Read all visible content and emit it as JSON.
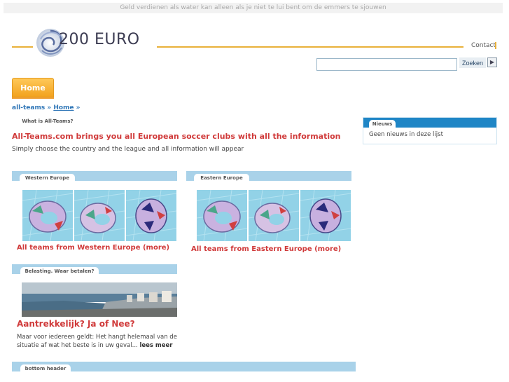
{
  "top_tagline": "Geld verdienen als water kan alleen als je niet te lui bent om de emmers te sjouwen",
  "logo": {
    "text": "200 EURO"
  },
  "header": {
    "contact": "Contact"
  },
  "search": {
    "placeholder": "",
    "button": "Zoeken",
    "go": "▶"
  },
  "nav": {
    "home": "Home"
  },
  "breadcrumb": {
    "root": "all-teams",
    "sep1": "»",
    "current": "Home",
    "sep2": "»"
  },
  "intro": {
    "tab": "What is All-Teams?",
    "headline": "All-Teams.com brings you all European soccer clubs with all the information",
    "text": "Simply choose the country and the league and all information will appear"
  },
  "regions": [
    {
      "tab": "Western Europe",
      "link": "All teams from Western Europe (more)"
    },
    {
      "tab": "Eastern Europe",
      "link": "All teams from Eastern Europe (more)"
    }
  ],
  "article": {
    "tab": "Belasting. Waar betalen?",
    "title": "Aantrekkelijk? Ja of Nee?",
    "body": "Maar voor iedereen geldt: Het hangt helemaal van de situatie af wat het beste is in uw geval...",
    "more": "lees meer"
  },
  "news": {
    "tab": "Nieuws",
    "empty": "Geen nieuws in deze lijst"
  },
  "footer": {
    "tab": "bottom header"
  },
  "colors": {
    "accent_orange": "#f2a21e",
    "link_red": "#d03a3a",
    "section_blue": "#a9d2e9",
    "news_blue": "#1f86c6"
  }
}
